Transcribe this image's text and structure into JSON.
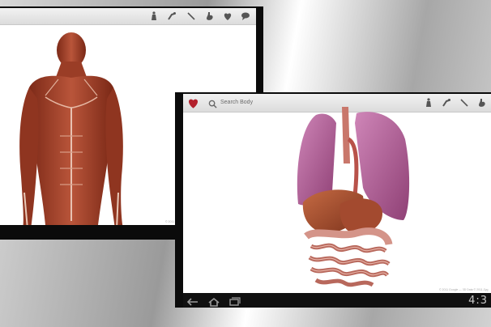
{
  "background_screen": {
    "toolbar_icons": [
      "body-icon",
      "bone-icon",
      "nerve-icon",
      "stomach-icon",
      "heart-icon",
      "speech-icon"
    ],
    "credit": "© 2011"
  },
  "foreground_screen": {
    "app_icon": "heart-logo-icon",
    "search": {
      "placeholder": "Search Body"
    },
    "toolbar_icons": [
      "body-icon",
      "bone-icon",
      "nerve-icon",
      "stomach-icon"
    ],
    "credit": "© 2011 Google — 3D Data © 2011 Zyg",
    "nav_icons": [
      "back-icon",
      "home-icon",
      "recent-apps-icon"
    ],
    "clock": "4:3"
  },
  "colors": {
    "bezel": "#0b0b0b",
    "muscle": "#a3432b",
    "lung": "#b5629a",
    "intestine": "#c97b6d"
  }
}
